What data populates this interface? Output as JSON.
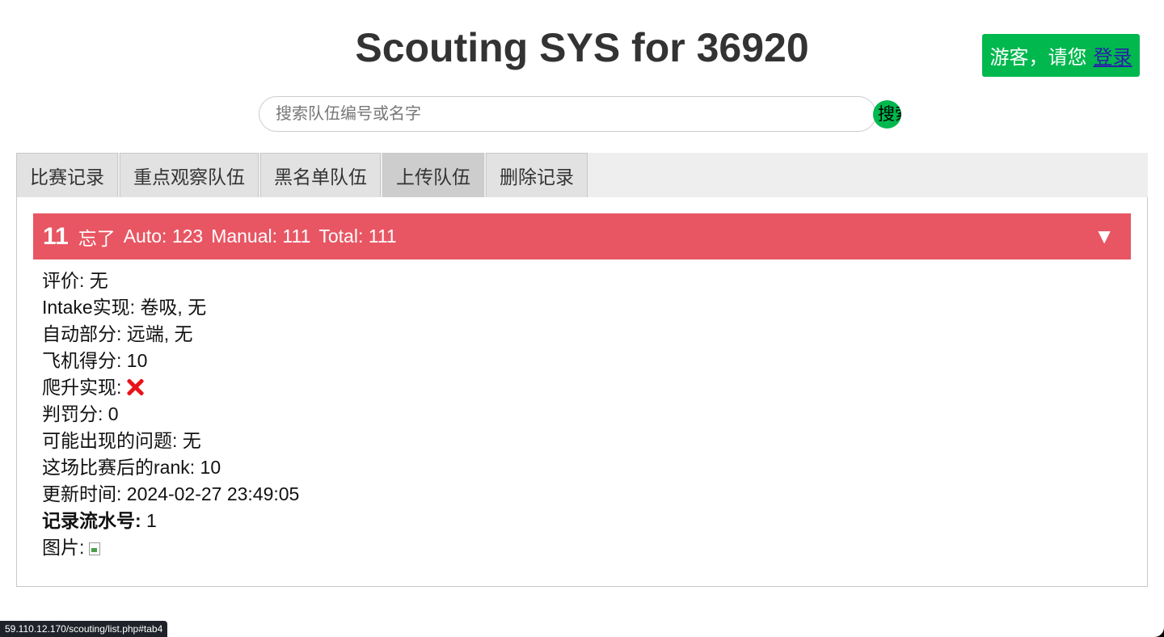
{
  "header": {
    "title": "Scouting SYS for 36920",
    "guest_text": "游客，请您",
    "login_link": "登录"
  },
  "search": {
    "placeholder": "搜索队伍编号或名字",
    "button_label": "搜索"
  },
  "tabs": [
    {
      "label": "比赛记录",
      "active": false
    },
    {
      "label": "重点观察队伍",
      "active": false
    },
    {
      "label": "黑名单队伍",
      "active": false
    },
    {
      "label": "上传队伍",
      "active": true
    },
    {
      "label": "删除记录",
      "active": false
    }
  ],
  "record": {
    "team_number": "11",
    "team_name": "忘了",
    "auto": "Auto: 123",
    "manual": "Manual: 111",
    "total": "Total: 111",
    "toggle": "▼",
    "fields": {
      "rating": "评价: 无",
      "intake": "Intake实现: 卷吸, 无",
      "auto_part": "自动部分: 远端, 无",
      "plane_score": "飞机得分: 10",
      "climb_label": "爬升实现:",
      "penalty": "判罚分: 0",
      "issues": "可能出现的问题: 无",
      "rank": "这场比赛后的rank: 10",
      "updated": "更新时间: 2024-02-27 23:49:05",
      "serial_label": "记录流水号:",
      "serial_value": " 1",
      "image_label": "图片:"
    },
    "climb_icon": "cross-icon",
    "image_icon": "broken-image-icon"
  },
  "status_bar": {
    "url": "59.110.12.170/scouting/list.php#tab4"
  },
  "colors": {
    "accent_green": "#00b84e",
    "record_header_red": "#e85663",
    "tab_bg": "#e2e2e2",
    "tab_active_bg": "#cdcdcd",
    "cross_red": "#e8131a"
  }
}
